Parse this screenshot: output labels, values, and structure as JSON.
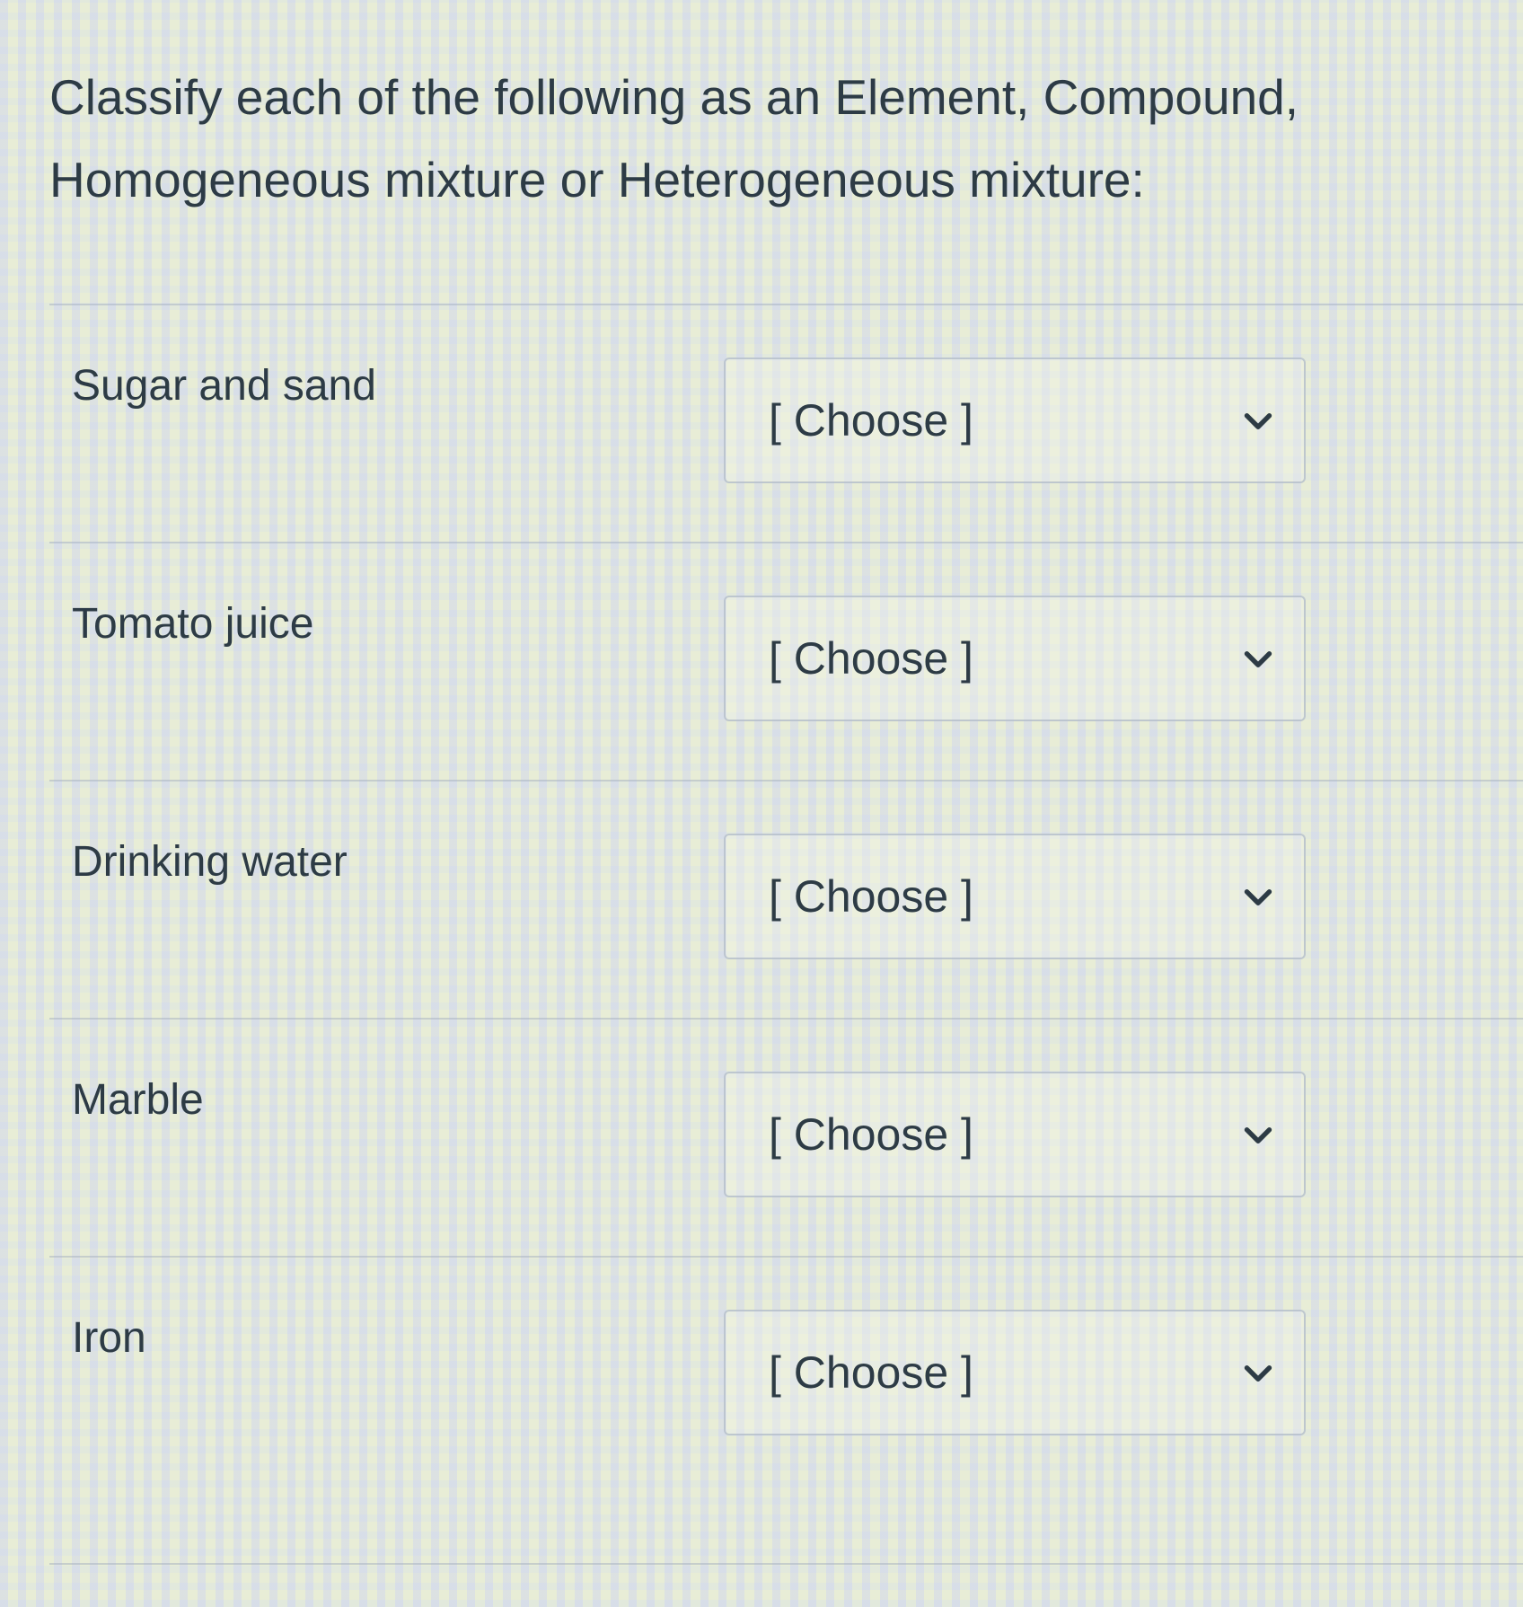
{
  "question": {
    "prompt_line1": "Classify each of the following as an Element, Compound,",
    "prompt_line2": "Homogeneous mixture or Heterogeneous mixture:"
  },
  "rows": [
    {
      "label": "Sugar and sand",
      "selected": "[ Choose ]"
    },
    {
      "label": "Tomato juice",
      "selected": "[ Choose ]"
    },
    {
      "label": "Drinking water",
      "selected": "[ Choose ]"
    },
    {
      "label": "Marble",
      "selected": "[ Choose ]"
    },
    {
      "label": "Iron",
      "selected": "[ Choose ]"
    }
  ],
  "icons": {
    "dropdown": "chevron-down-icon"
  }
}
